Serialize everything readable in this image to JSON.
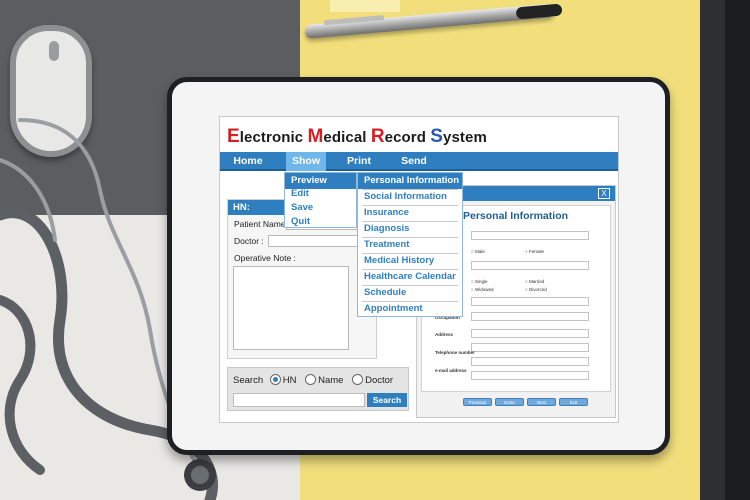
{
  "app": {
    "title_parts": [
      {
        "cap": "E",
        "rest": "lectronic "
      },
      {
        "cap": "M",
        "rest": "edical "
      },
      {
        "cap": "R",
        "rest": "ecord "
      },
      {
        "cap": "S",
        "rest": "ystem"
      }
    ]
  },
  "menubar": {
    "items": [
      "Home",
      "Show",
      "Print",
      "Send"
    ],
    "active": "Show"
  },
  "show_menu": {
    "items": [
      "Preview",
      "Edit",
      "Save",
      "Quit"
    ],
    "highlighted": "Preview"
  },
  "preview_submenu": {
    "items": [
      "Personal Information",
      "Social Information",
      "Insurance",
      "Diagnosis",
      "Treatment",
      "Medical History",
      "Healthcare Calendar",
      "Schedule",
      "Appointment"
    ],
    "highlighted": "Personal Information"
  },
  "hn_panel": {
    "header": "HN:",
    "patient_name_label": "Patient Name",
    "doctor_label": "Doctor :",
    "operative_note_label": "Operative Note :"
  },
  "search": {
    "label": "Search",
    "options": [
      "HN",
      "Name",
      "Doctor"
    ],
    "selected": "HN",
    "button": "Search"
  },
  "personal_info": {
    "title": "Personal Information",
    "close_glyph": "X",
    "sex_options": [
      "Male",
      "Female"
    ],
    "status_options": [
      "Single",
      "Married",
      "Widowed",
      "Divorced"
    ],
    "field_labels": [
      "Occupation",
      "Address",
      "Telephone number",
      "e-mail address"
    ],
    "buttons": [
      "Previous",
      "Done",
      "Next",
      "Exit"
    ]
  },
  "colors": {
    "accent": "#2f7fc0",
    "title_red": "#d71f26",
    "title_blue": "#2356b8"
  }
}
